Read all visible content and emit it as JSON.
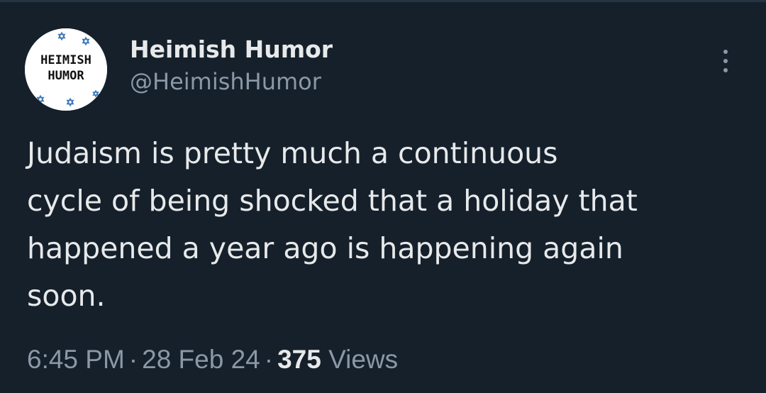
{
  "tweet": {
    "author": {
      "display_name": "Heimish Humor",
      "handle": "@HeimishHumor",
      "avatar_text": [
        "HEIMISH",
        "HUMOR"
      ]
    },
    "text_lines": [
      "Judaism is pretty much a continuous",
      "cycle of being shocked that a holiday that",
      "happened a year ago is happening again",
      "soon."
    ],
    "time": "6:45 PM",
    "separator": "·",
    "date": "28 Feb 24",
    "views_count": "375",
    "views_label": "Views",
    "more_icon": "more-vertical-icon"
  },
  "colors": {
    "background": "#15202b",
    "primary_text": "#e7e9ea",
    "secondary_text": "#8b98a5"
  }
}
